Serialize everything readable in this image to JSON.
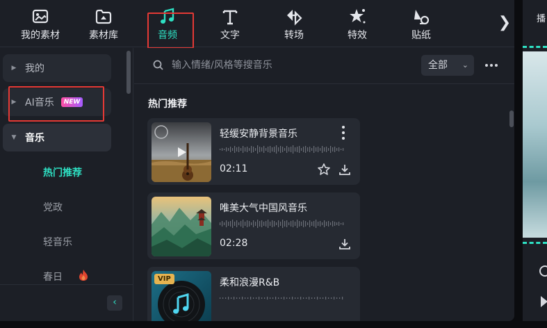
{
  "toolbar": {
    "tabs": [
      {
        "label": "我的素材",
        "icon": "my-assets-icon"
      },
      {
        "label": "素材库",
        "icon": "library-icon"
      },
      {
        "label": "音频",
        "icon": "music-note-icon",
        "active": true
      },
      {
        "label": "文字",
        "icon": "text-icon"
      },
      {
        "label": "转场",
        "icon": "transition-icon"
      },
      {
        "label": "特效",
        "icon": "effects-icon"
      },
      {
        "label": "贴纸",
        "icon": "sticker-icon"
      }
    ],
    "more_glyph": "❯"
  },
  "sidebar": {
    "items": [
      {
        "label": "我的",
        "caret": "▶"
      },
      {
        "label": "AI音乐",
        "caret": "▶",
        "badge": "NEW"
      },
      {
        "label": "音乐",
        "caret": "▼"
      }
    ],
    "sub_items": [
      {
        "label": "热门推荐",
        "active": true
      },
      {
        "label": "党政"
      },
      {
        "label": "轻音乐"
      },
      {
        "label": "春日"
      }
    ],
    "collapse_glyph": "‹"
  },
  "main": {
    "search": {
      "placeholder": "输入情绪/风格等搜音乐"
    },
    "filter": {
      "value": "全部"
    },
    "section_title": "热门推荐",
    "cards": [
      {
        "title": "轻缓安静背景音乐",
        "duration": "02:11"
      },
      {
        "title": "唯美大气中国风音乐",
        "duration": "02:28"
      },
      {
        "title": "柔和浪漫R&B",
        "duration": "",
        "badge": "VIP"
      }
    ]
  },
  "preview": {
    "tab_label": "播"
  },
  "colors": {
    "accent": "#2ee0c3",
    "highlight": "#e53935",
    "background": "#1c1f26",
    "card": "#262a32"
  }
}
